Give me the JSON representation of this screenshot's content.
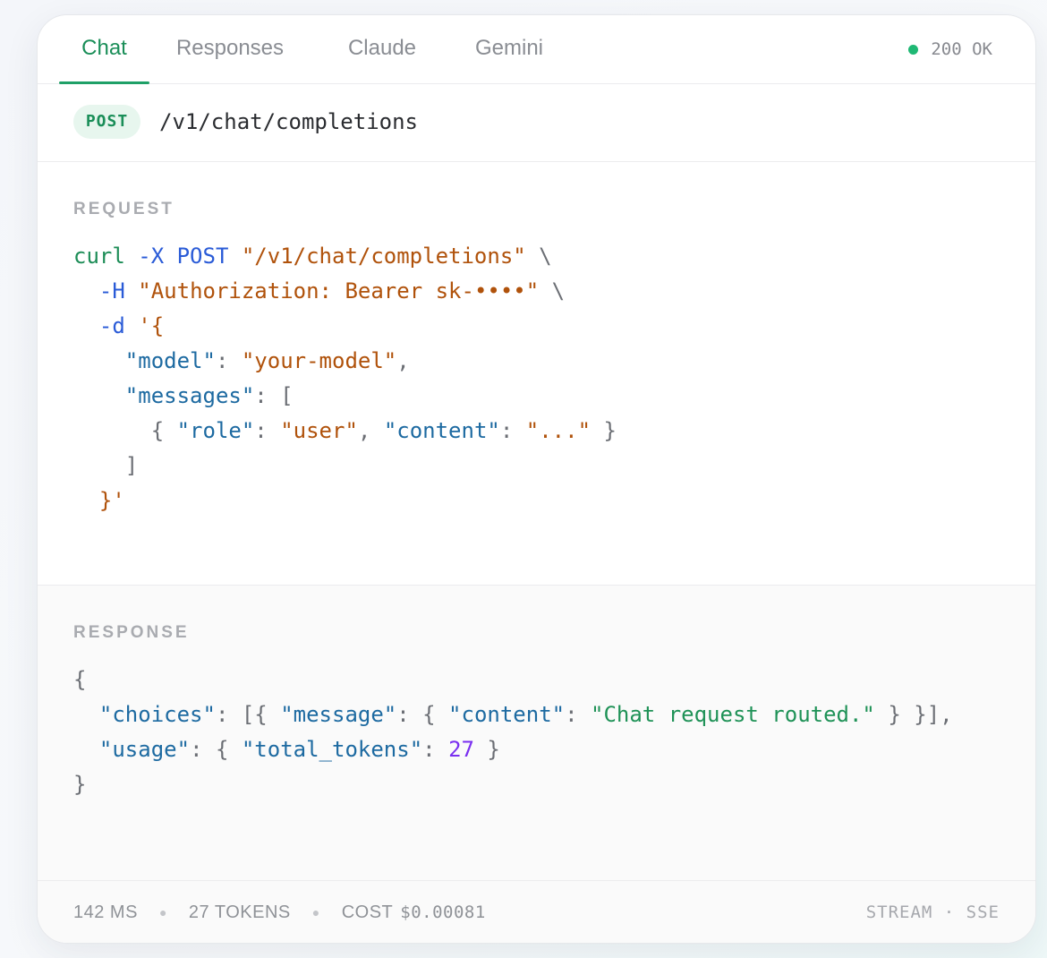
{
  "tabs": [
    {
      "label": "Chat",
      "active": true
    },
    {
      "label": "Responses",
      "active": false
    },
    {
      "label": "Claude",
      "active": false
    },
    {
      "label": "Gemini",
      "active": false
    }
  ],
  "status": {
    "text": "200 OK",
    "color": "#1fb874"
  },
  "endpoint": {
    "method": "POST",
    "path": "/v1/chat/completions"
  },
  "request": {
    "label": "REQUEST",
    "lines": [
      [
        [
          "cmd",
          "curl "
        ],
        [
          "flag",
          "-X POST "
        ],
        [
          "str",
          "\"/v1/chat/completions\""
        ],
        [
          "punc",
          " \\"
        ]
      ],
      [
        [
          "punc",
          "  "
        ],
        [
          "flag",
          "-H "
        ],
        [
          "str",
          "\"Authorization: Bearer sk-••••\""
        ],
        [
          "punc",
          " \\"
        ]
      ],
      [
        [
          "punc",
          "  "
        ],
        [
          "flag",
          "-d "
        ],
        [
          "str",
          "'{"
        ]
      ],
      [
        [
          "punc",
          "    "
        ],
        [
          "key",
          "\"model\""
        ],
        [
          "punc",
          ": "
        ],
        [
          "str",
          "\"your-model\""
        ],
        [
          "punc",
          ","
        ]
      ],
      [
        [
          "punc",
          "    "
        ],
        [
          "key",
          "\"messages\""
        ],
        [
          "punc",
          ": ["
        ]
      ],
      [
        [
          "punc",
          "      { "
        ],
        [
          "key",
          "\"role\""
        ],
        [
          "punc",
          ": "
        ],
        [
          "str",
          "\"user\""
        ],
        [
          "punc",
          ", "
        ],
        [
          "key",
          "\"content\""
        ],
        [
          "punc",
          ": "
        ],
        [
          "str",
          "\"...\""
        ],
        [
          "punc",
          " }"
        ]
      ],
      [
        [
          "punc",
          "    ]"
        ]
      ],
      [
        [
          "punc",
          "  "
        ],
        [
          "str",
          "}'"
        ]
      ]
    ]
  },
  "response": {
    "label": "RESPONSE",
    "lines": [
      [
        [
          "punc",
          "{"
        ]
      ],
      [
        [
          "punc",
          "  "
        ],
        [
          "key",
          "\"choices\""
        ],
        [
          "punc",
          ": [{ "
        ],
        [
          "key",
          "\"message\""
        ],
        [
          "punc",
          ": { "
        ],
        [
          "key",
          "\"content\""
        ],
        [
          "punc",
          ": "
        ],
        [
          "val",
          "\"Chat request routed.\""
        ],
        [
          "punc",
          " } }],"
        ]
      ],
      [
        [
          "punc",
          "  "
        ],
        [
          "key",
          "\"usage\""
        ],
        [
          "punc",
          ": { "
        ],
        [
          "key",
          "\"total_tokens\""
        ],
        [
          "punc",
          ": "
        ],
        [
          "num",
          "27"
        ],
        [
          "punc",
          " }"
        ]
      ],
      [
        [
          "punc",
          "}"
        ]
      ]
    ]
  },
  "footer": {
    "latency": "142 MS",
    "tokens": "27 TOKENS",
    "cost_label": "COST",
    "cost_value": "$0.00081",
    "mode": "STREAM · SSE"
  },
  "colors": {
    "accent": "#1a8e58",
    "method_bg": "#e7f6ee"
  }
}
